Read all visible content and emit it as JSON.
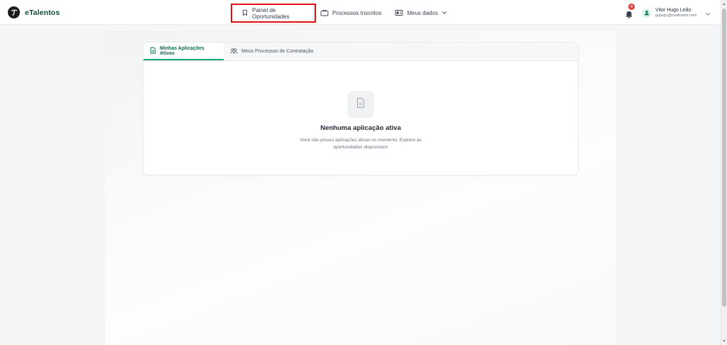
{
  "brand": {
    "name": "eTalentos",
    "logo_letter": "T"
  },
  "nav": {
    "items": [
      {
        "label": "Painel de Oportunidades",
        "icon": "bookmark-icon"
      },
      {
        "label": "Processos Inscritos",
        "icon": "briefcase-icon"
      },
      {
        "label": "Meus dados",
        "icon": "id-card-icon"
      }
    ]
  },
  "notifications": {
    "count": "0"
  },
  "user": {
    "name": "Vitor Hugo Leão",
    "email": "gujiapy@mailinator.com"
  },
  "tabs": [
    {
      "label": "Minhas Aplicações Ativas",
      "icon": "document-icon",
      "active": true
    },
    {
      "label": "Meus Processos de Contratação",
      "icon": "users-icon",
      "active": false
    }
  ],
  "empty_state": {
    "title": "Nenhuma aplicação ativa",
    "description": "Você não possui aplicações ativas no momento. Explore as oportunidades disponíveis!"
  },
  "colors": {
    "brand": "#0f4c3a",
    "accent": "#17a672",
    "highlight": "#e01010",
    "badge": "#e53935"
  }
}
